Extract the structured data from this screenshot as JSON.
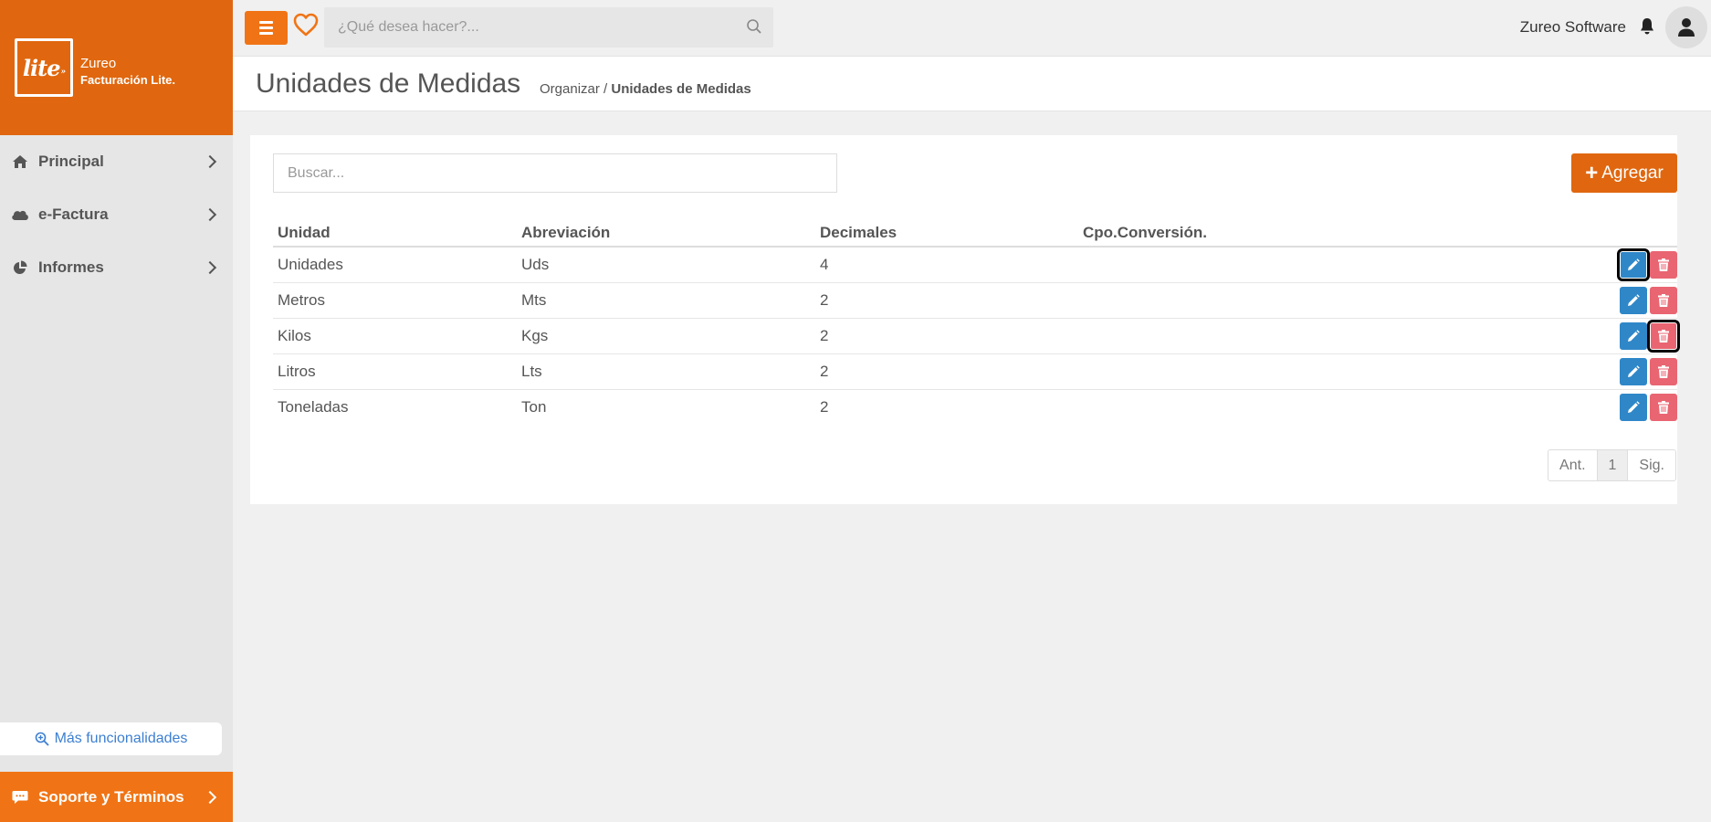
{
  "brand": {
    "logo": "lite",
    "name": "Zureo",
    "product": "Facturación Lite."
  },
  "sidebar": {
    "items": [
      {
        "label": "Principal",
        "icon": "home-icon"
      },
      {
        "label": "e-Factura",
        "icon": "cloud-icon"
      },
      {
        "label": "Informes",
        "icon": "pie-chart-icon"
      }
    ],
    "more_label": "Más funcionalidades",
    "support_label": "Soporte y Términos"
  },
  "topbar": {
    "search_placeholder": "¿Qué desea hacer?...",
    "user_name": "Zureo Software"
  },
  "header": {
    "title": "Unidades de Medidas",
    "breadcrumb_parent": "Organizar",
    "breadcrumb_separator": " / ",
    "breadcrumb_current": "Unidades de Medidas"
  },
  "card": {
    "search_placeholder": "Buscar...",
    "add_label": "Agregar"
  },
  "table": {
    "headers": [
      "Unidad",
      "Abreviación",
      "Decimales",
      "Cpo.Conversión."
    ],
    "rows": [
      [
        "Unidades",
        "Uds",
        "4",
        ""
      ],
      [
        "Metros",
        "Mts",
        "2",
        ""
      ],
      [
        "Kilos",
        "Kgs",
        "2",
        ""
      ],
      [
        "Litros",
        "Lts",
        "2",
        ""
      ],
      [
        "Toneladas",
        "Ton",
        "2",
        ""
      ]
    ]
  },
  "pagination": {
    "prev": "Ant.",
    "current": "1",
    "next": "Sig."
  },
  "colors": {
    "brand_orange": "#e0670f",
    "support_orange": "#f07415",
    "edit_blue": "#2f87c8",
    "delete_red": "#e86571"
  }
}
